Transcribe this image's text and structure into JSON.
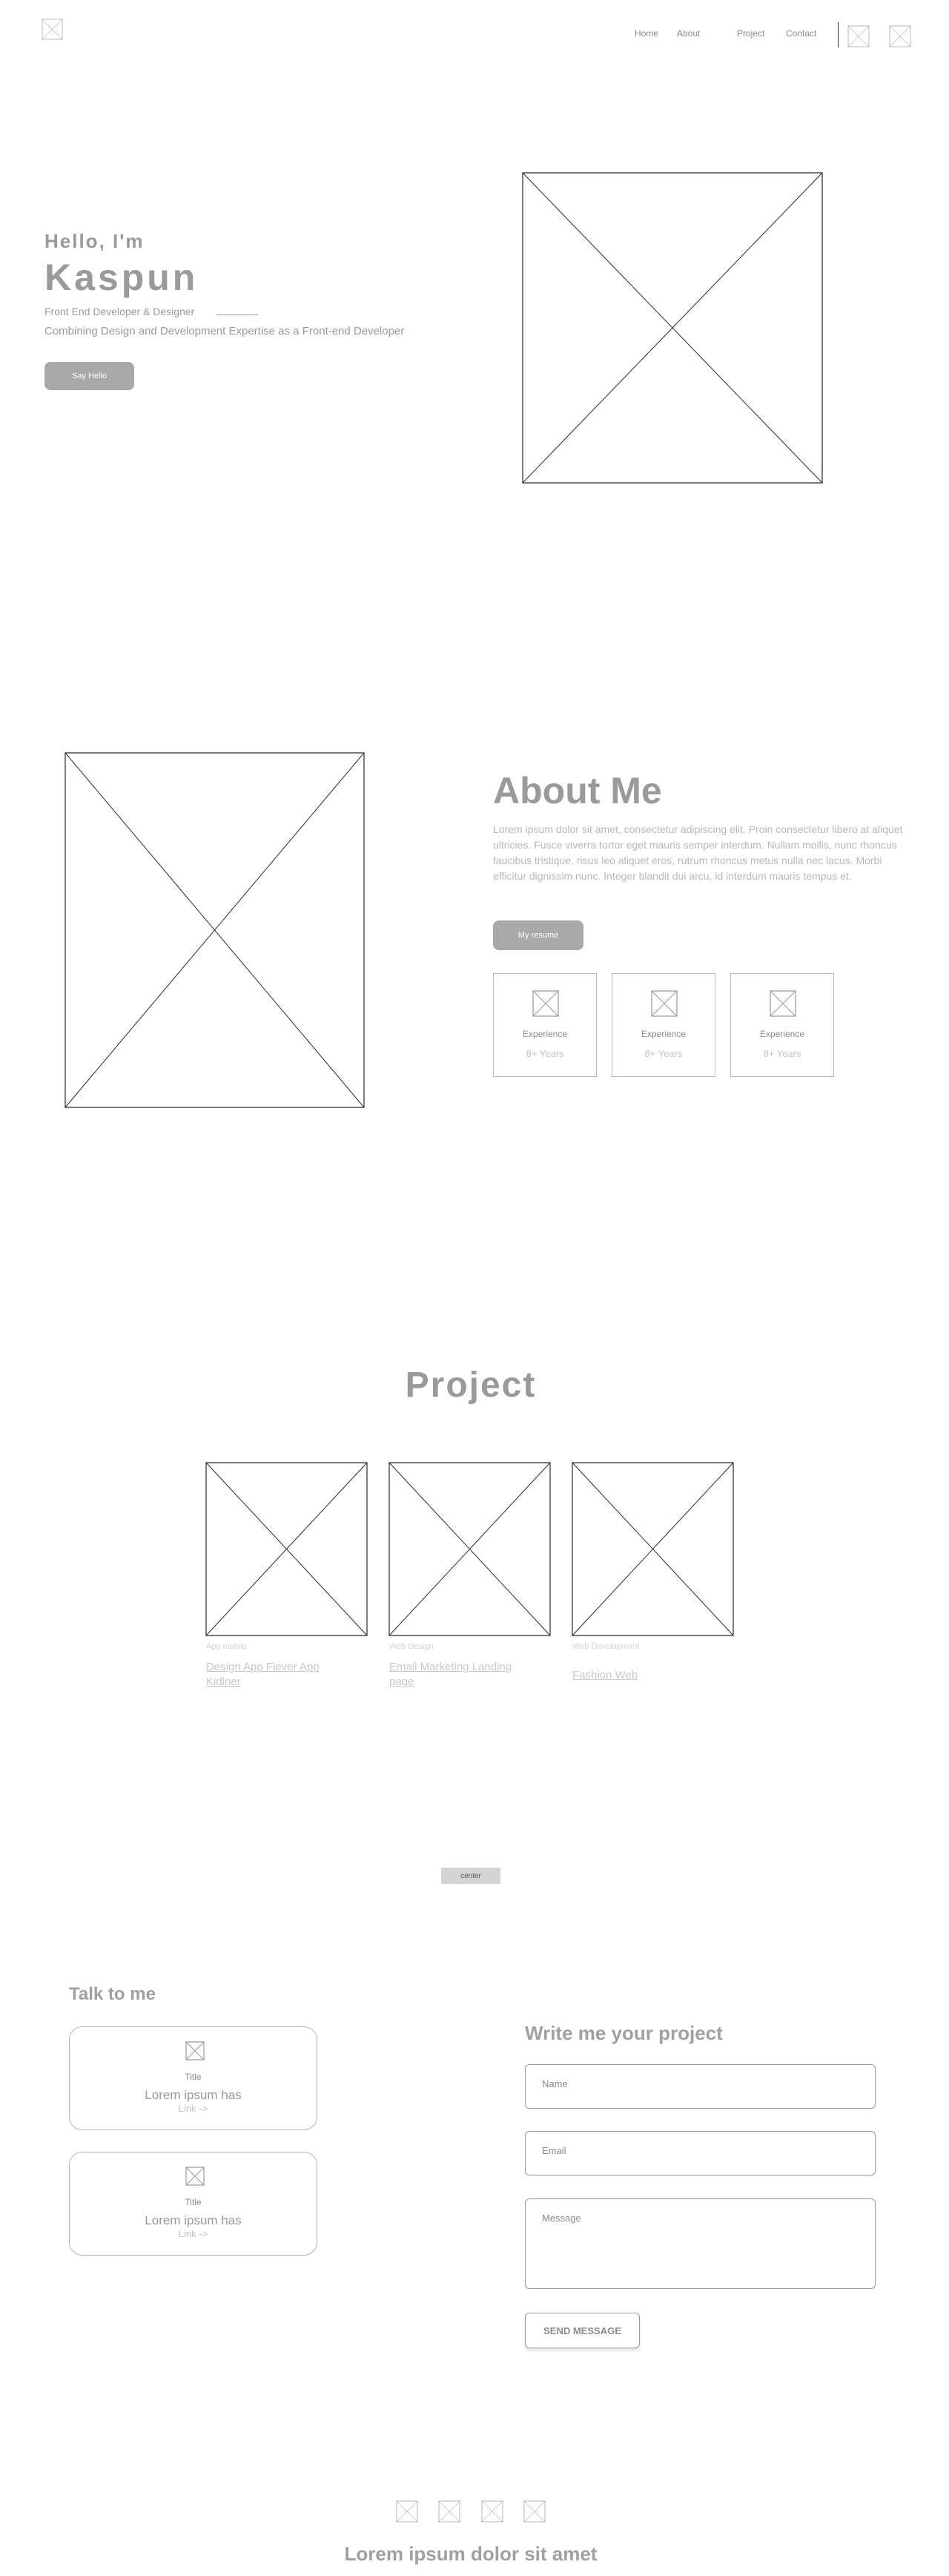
{
  "header": {
    "logo_icon": "logo-placeholder-image",
    "nav": [
      "Home",
      "About",
      "Project",
      "Contact"
    ],
    "icons": [
      "social-icon-placeholder",
      "social-icon-placeholder"
    ]
  },
  "hero": {
    "greeting": "Hello, I'm",
    "name": "Kaspun",
    "role": "Front End Developer & Designer",
    "tagline": "Combining Design and Development Expertise as a Front-end Developer",
    "button_label": "Say Hello",
    "image": "hero-image-placeholder"
  },
  "about": {
    "title": "About Me",
    "text": "Lorem ipsum dolor sit amet, consectetur adipiscing elit. Proin consectetur libero at aliquet ultricies. Fusce viverra tortor eget mauris semper interdum. Nullam mollis, nunc rhoncus faucibus tristique, risus leo aliquet eros, rutrum rhoncus metus nulla nec lacus. Morbi efficitur dignissim nunc. Integer blandit dui arcu, id interdum mauris tempus et.",
    "button_label": "My resume",
    "image": "about-image-placeholder",
    "cards": [
      {
        "label": "Experience",
        "value": "8+ Years",
        "icon": "experience-icon-placeholder"
      },
      {
        "label": "Experience",
        "value": "8+ Years",
        "icon": "experience-icon-placeholder"
      },
      {
        "label": "Experience",
        "value": "8+ Years",
        "icon": "experience-icon-placeholder"
      }
    ]
  },
  "projects": {
    "title": "Project",
    "items": [
      {
        "category": "App mobile",
        "name": "Design App Fiever App Kidlner"
      },
      {
        "category": "Web Design",
        "name": "Email Marketing Landing page"
      },
      {
        "category": "Web Development",
        "name": "Fashion Web"
      }
    ]
  },
  "center_label": "center",
  "contact": {
    "talk_title": "Talk to me",
    "cards": [
      {
        "title": "Title",
        "text": "Lorem ipsum has",
        "link": "Link ->"
      },
      {
        "title": "Title",
        "text": "Lorem ipsum has",
        "link": "Link ->"
      }
    ],
    "form_title": "Write me your project",
    "name_placeholder": "Name",
    "email_placeholder": "Email",
    "message_placeholder": "Message",
    "send_label": "SEND MESSAGE"
  },
  "footer": {
    "icons": [
      "social-icon-placeholder",
      "social-icon-placeholder",
      "social-icon-placeholder",
      "social-icon-placeholder"
    ],
    "text": "Lorem ipsum dolor sit amet"
  },
  "colors": {
    "text_gray": "#9a9a9a",
    "button_gray": "#a8a8a8",
    "placeholder_stroke": "#2b2b2b"
  }
}
